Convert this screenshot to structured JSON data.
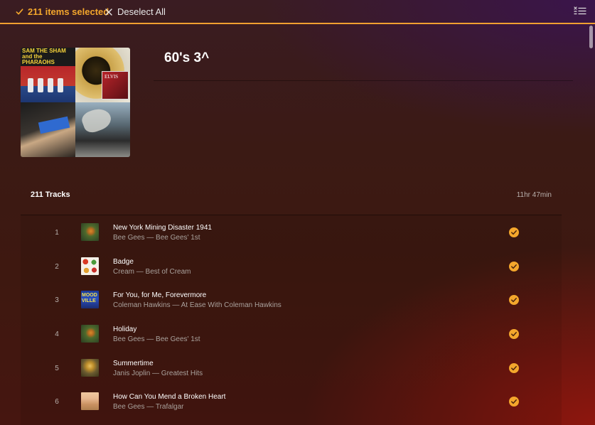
{
  "selection": {
    "count_label": "211 items selected",
    "deselect_label": "Deselect All"
  },
  "playlist": {
    "title": "60's 3^",
    "cover_text": {
      "tile1": "SAM THE SHAM and the PHARAOHS",
      "tile2": "ELVIS",
      "tile3_top": "",
      "tile4": ""
    },
    "tracks_label": "211 Tracks",
    "duration": "11hr 47min"
  },
  "tracks": [
    {
      "number": "1",
      "title": "New York Mining Disaster 1941",
      "subtitle": "Bee Gees — Bee Gees' 1st",
      "art": "beegees"
    },
    {
      "number": "2",
      "title": "Badge",
      "subtitle": "Cream — Best of Cream",
      "art": "cream"
    },
    {
      "number": "3",
      "title": "For You, for Me, Forevermore",
      "subtitle": "Coleman Hawkins — At Ease With Coleman Hawkins",
      "art": "hawkins"
    },
    {
      "number": "4",
      "title": "Holiday",
      "subtitle": "Bee Gees — Bee Gees' 1st",
      "art": "beegees"
    },
    {
      "number": "5",
      "title": "Summertime",
      "subtitle": "Janis Joplin — Greatest Hits",
      "art": "joplin"
    },
    {
      "number": "6",
      "title": "How Can You Mend a Broken Heart",
      "subtitle": "Bee Gees — Trafalgar",
      "art": "trafalgar"
    }
  ],
  "icons": {
    "selected": "check-icon",
    "deselect": "close-icon",
    "queue": "queue-list-icon",
    "track_selected": "check-circle-icon"
  },
  "colors": {
    "accent": "#f4a72c",
    "check_fill": "#f4a72c",
    "text_primary": "#ffffff",
    "text_secondary": "#a9a19c"
  },
  "hawkins_art_text": "MOOD VILLE"
}
